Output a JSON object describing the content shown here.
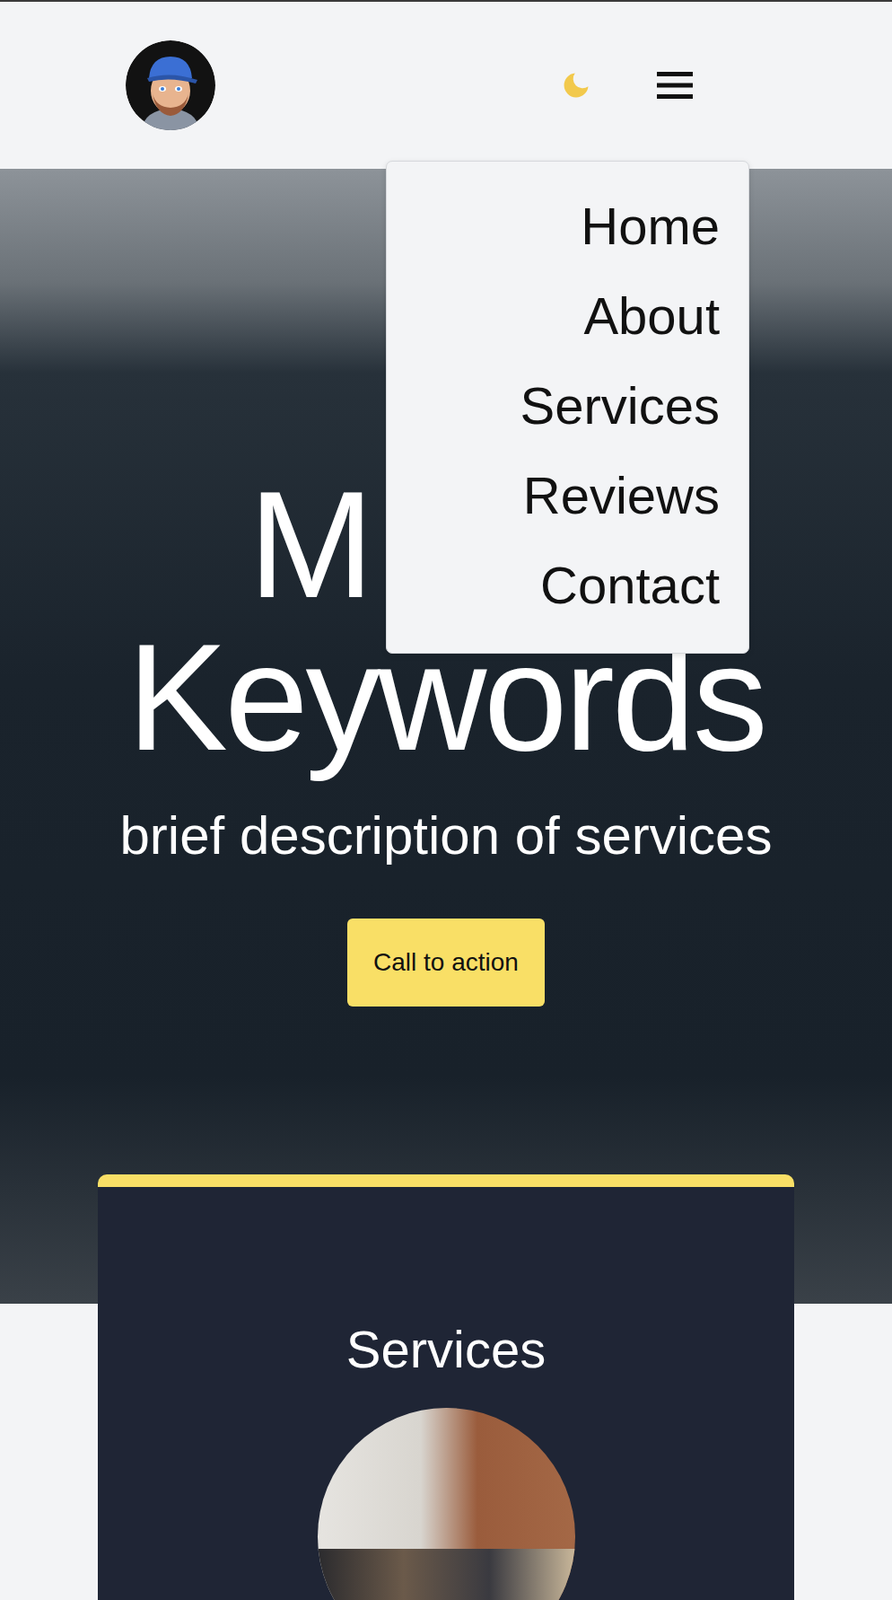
{
  "nav": {
    "expanded": true,
    "items": [
      {
        "label": "Home"
      },
      {
        "label": "About"
      },
      {
        "label": "Services"
      },
      {
        "label": "Reviews"
      },
      {
        "label": "Contact"
      }
    ]
  },
  "hero": {
    "title_lines": [
      "M",
      "Keywords"
    ],
    "subtitle": "brief description of services",
    "cta": "Call to action"
  },
  "services": {
    "title": "Services"
  }
}
